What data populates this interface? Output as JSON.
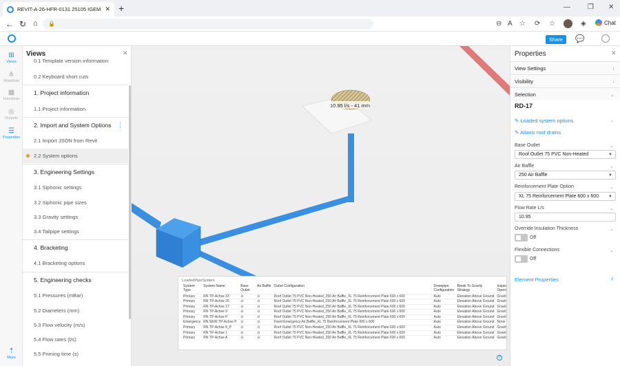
{
  "browser": {
    "tab_title": "REVIT-A-26-HFR-0131 25105 IGEM",
    "chat_label": "Chat"
  },
  "app": {
    "share_label": "Share",
    "rail": [
      {
        "label": "Views",
        "icon": "views-icon"
      },
      {
        "label": "Workflow",
        "icon": "workflow-icon"
      },
      {
        "label": "Functions",
        "icon": "functions-icon"
      },
      {
        "label": "Outputs",
        "icon": "outputs-icon"
      },
      {
        "label": "Properties",
        "icon": "properties-icon"
      },
      {
        "label": "More",
        "icon": "more-icon"
      }
    ]
  },
  "views": {
    "title": "Views",
    "items": [
      {
        "type": "item",
        "label": "0.1 Template version information"
      },
      {
        "type": "item",
        "label": "0.2 Keyboard short cuts"
      },
      {
        "type": "head",
        "label": "1. Project information"
      },
      {
        "type": "item",
        "label": "1.1 Project information"
      },
      {
        "type": "head",
        "label": "2. Import and System Options"
      },
      {
        "type": "item",
        "label": "2.1 Import JSON from Revit"
      },
      {
        "type": "item",
        "label": "2.2 System options",
        "selected": true
      },
      {
        "type": "head",
        "label": "3. Engineering Settings"
      },
      {
        "type": "item",
        "label": "3.1 Siphonic settings"
      },
      {
        "type": "item",
        "label": "3.2 Siphonic pipe sizes"
      },
      {
        "type": "item",
        "label": "3.3 Gravity settings"
      },
      {
        "type": "item",
        "label": "3.4 Tailpipe settings"
      },
      {
        "type": "head",
        "label": "4. Bracketing"
      },
      {
        "type": "item",
        "label": "4.1 Bracketing options"
      },
      {
        "type": "head",
        "label": "5. Engineering checks"
      },
      {
        "type": "item",
        "label": "5.1 Pressures (mBar)"
      },
      {
        "type": "item",
        "label": "5.2 Diameters (mm)"
      },
      {
        "type": "item",
        "label": "5.3 Flow velocity (m/s)"
      },
      {
        "type": "item",
        "label": "5.4 Flow rates (l/s)"
      },
      {
        "type": "item",
        "label": "5.5 Priming time (s)"
      }
    ]
  },
  "viewport": {
    "outlet_label": "10.95 l/s - 41 mm"
  },
  "table": {
    "caption": "LoadedPipeSystem",
    "headers": [
      "System\nType",
      "System Name",
      "Base\nOutlet",
      "Air Baffle",
      "Outlet Configuration",
      "Downpipe\nConfiguration",
      "Break To Gravity\nStrategy",
      "Inspec\nOpeni"
    ],
    "rows": [
      [
        "Primary",
        "RN TP-Achse 33",
        "⊙",
        "⊙",
        "Roof Outlet 75 PVC Non-Heated_250 Air Baffle_XL 75 Reinforcement Plate 600 x 600",
        "Auto",
        "Elevation Above Ground",
        "Gravity"
      ],
      [
        "Primary",
        "RN TP-Achse 25",
        "⊙",
        "⊙",
        "Roof Outlet 75 PVC Non-Heated_250 Air Baffle_XL 75 Reinforcement Plate 600 x 600",
        "Auto",
        "Elevation Above Ground",
        "Gravity"
      ],
      [
        "Primary",
        "RN TP-Achse 17",
        "⊙",
        "⊙",
        "Roof Outlet 75 PVC Non-Heated_250 Air Baffle_XL 75 Reinforcement Plate 600 x 600",
        "Auto",
        "Elevation Above Ground",
        "Gravity"
      ],
      [
        "Primary",
        "RN TP-Achse 9",
        "⊙",
        "⊙",
        "Roof Outlet 75 PVC Non-Heated_250 Air Baffle_XL 75 Reinforcement Plate 600 x 600",
        "Auto",
        "Elevation Above Ground",
        "Gravity"
      ],
      [
        "Primary",
        "RN TP-Achse P",
        "⊙",
        "⊙",
        "Roof Outlet 75 PVC Non-Heated_250 Air Baffle_XL 75 Reinforcement Plate 600 x 600",
        "Auto",
        "Elevation Above Ground",
        "Gravity"
      ],
      [
        "Emergency",
        "RN NEW TP-Achse P",
        "⊙",
        "⊙",
        "Fixed Emergency Air Baffle_XL 75 Reinforcement Plate 600 x 600",
        "Auto",
        "Elevation Above Ground",
        "None"
      ],
      [
        "Primary",
        "RN TP-Achse 9_P",
        "⊙",
        "⊙",
        "Roof Outlet 75 PVC Non-Heated_250 Air Baffle_XL 75 Reinforcement Plate 600 x 600",
        "Auto",
        "Elevation Above Ground",
        "Gravity"
      ],
      [
        "Primary",
        "RN TP-Achse 1",
        "⊙",
        "⊙",
        "Roof Outlet 75 PVC Non-Heated_250 Air Baffle_XL 75 Reinforcement Plate 600 x 600",
        "Auto",
        "Elevation Above Ground",
        "Gravity"
      ],
      [
        "Primary",
        "RN TP-Achse A",
        "⊙",
        "⊙",
        "Roof Outlet 75 PVC Non-Heated_250 Air Baffle_XL 75 Reinforcement Plate 600 x 600",
        "Auto",
        "Elevation Above Ground",
        "Gravity"
      ]
    ]
  },
  "properties": {
    "title": "Properties",
    "sections": [
      "View Settings",
      "Visibility",
      "Selection"
    ],
    "element_id": "RD-17",
    "links": [
      "Loaded system options",
      "Aliaxis roof drains"
    ],
    "fields": [
      {
        "label": "Base Outlet",
        "value": "Roof Outlet 75 PVC Non-Heated",
        "dropdown": true
      },
      {
        "label": "Air Baffle",
        "value": "250 Air Baffle",
        "dropdown": true
      },
      {
        "label": "Reinforcement Plate Option",
        "value": "XL 75 Reinforcement Plate 600 x 600",
        "dropdown": true
      },
      {
        "label": "Flow Rate L/s",
        "value": "10.95",
        "dropdown": false
      }
    ],
    "toggles": [
      {
        "label": "Override Insulation Thickness",
        "state": "Off"
      },
      {
        "label": "Flexible Connections",
        "state": "Off"
      }
    ],
    "element_properties_label": "Element Properties"
  },
  "colors": {
    "accent": "#1a8fe3",
    "pipe": "#3a8fe0",
    "red_pipe": "#e07a7a"
  }
}
